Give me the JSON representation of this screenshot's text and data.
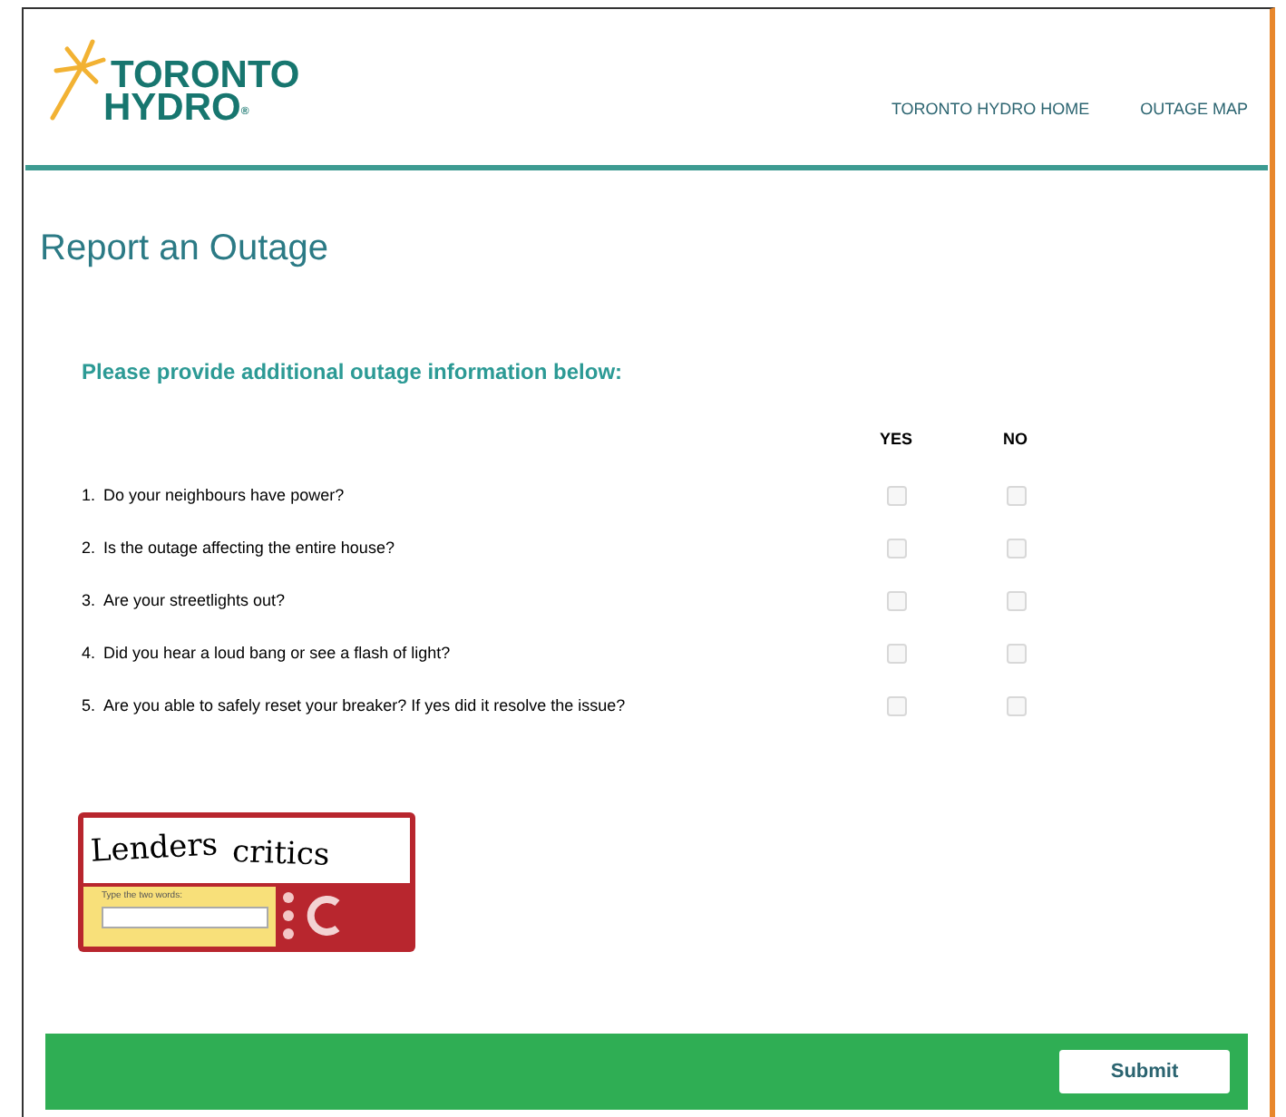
{
  "header": {
    "logo": {
      "line_1": "TORONTO",
      "line_2": "HYDRO",
      "mark": "®"
    },
    "nav": [
      {
        "label": "TORONTO HYDRO HOME"
      },
      {
        "label": "OUTAGE MAP"
      }
    ]
  },
  "page_title": "Report an Outage",
  "form": {
    "heading": "Please provide additional outage information below:",
    "columns": [
      "YES",
      "NO"
    ],
    "questions": [
      {
        "number": "1.",
        "text": "Do your neighbours have power?",
        "yes": false,
        "no": false
      },
      {
        "number": "2.",
        "text": "Is the outage affecting the entire house?",
        "yes": false,
        "no": false
      },
      {
        "number": "3.",
        "text": "Are your streetlights out?",
        "yes": false,
        "no": false
      },
      {
        "number": "4.",
        "text": "Did you hear a loud bang or see a flash of light?",
        "yes": false,
        "no": false
      },
      {
        "number": "5.",
        "text": "Are you able to safely reset your breaker? If yes did it resolve the issue?",
        "yes": false,
        "no": false
      }
    ]
  },
  "captcha": {
    "words": [
      "Lenders",
      "critics"
    ],
    "prompt": "Type the two words:"
  },
  "footer": {
    "submit": "Submit"
  }
}
